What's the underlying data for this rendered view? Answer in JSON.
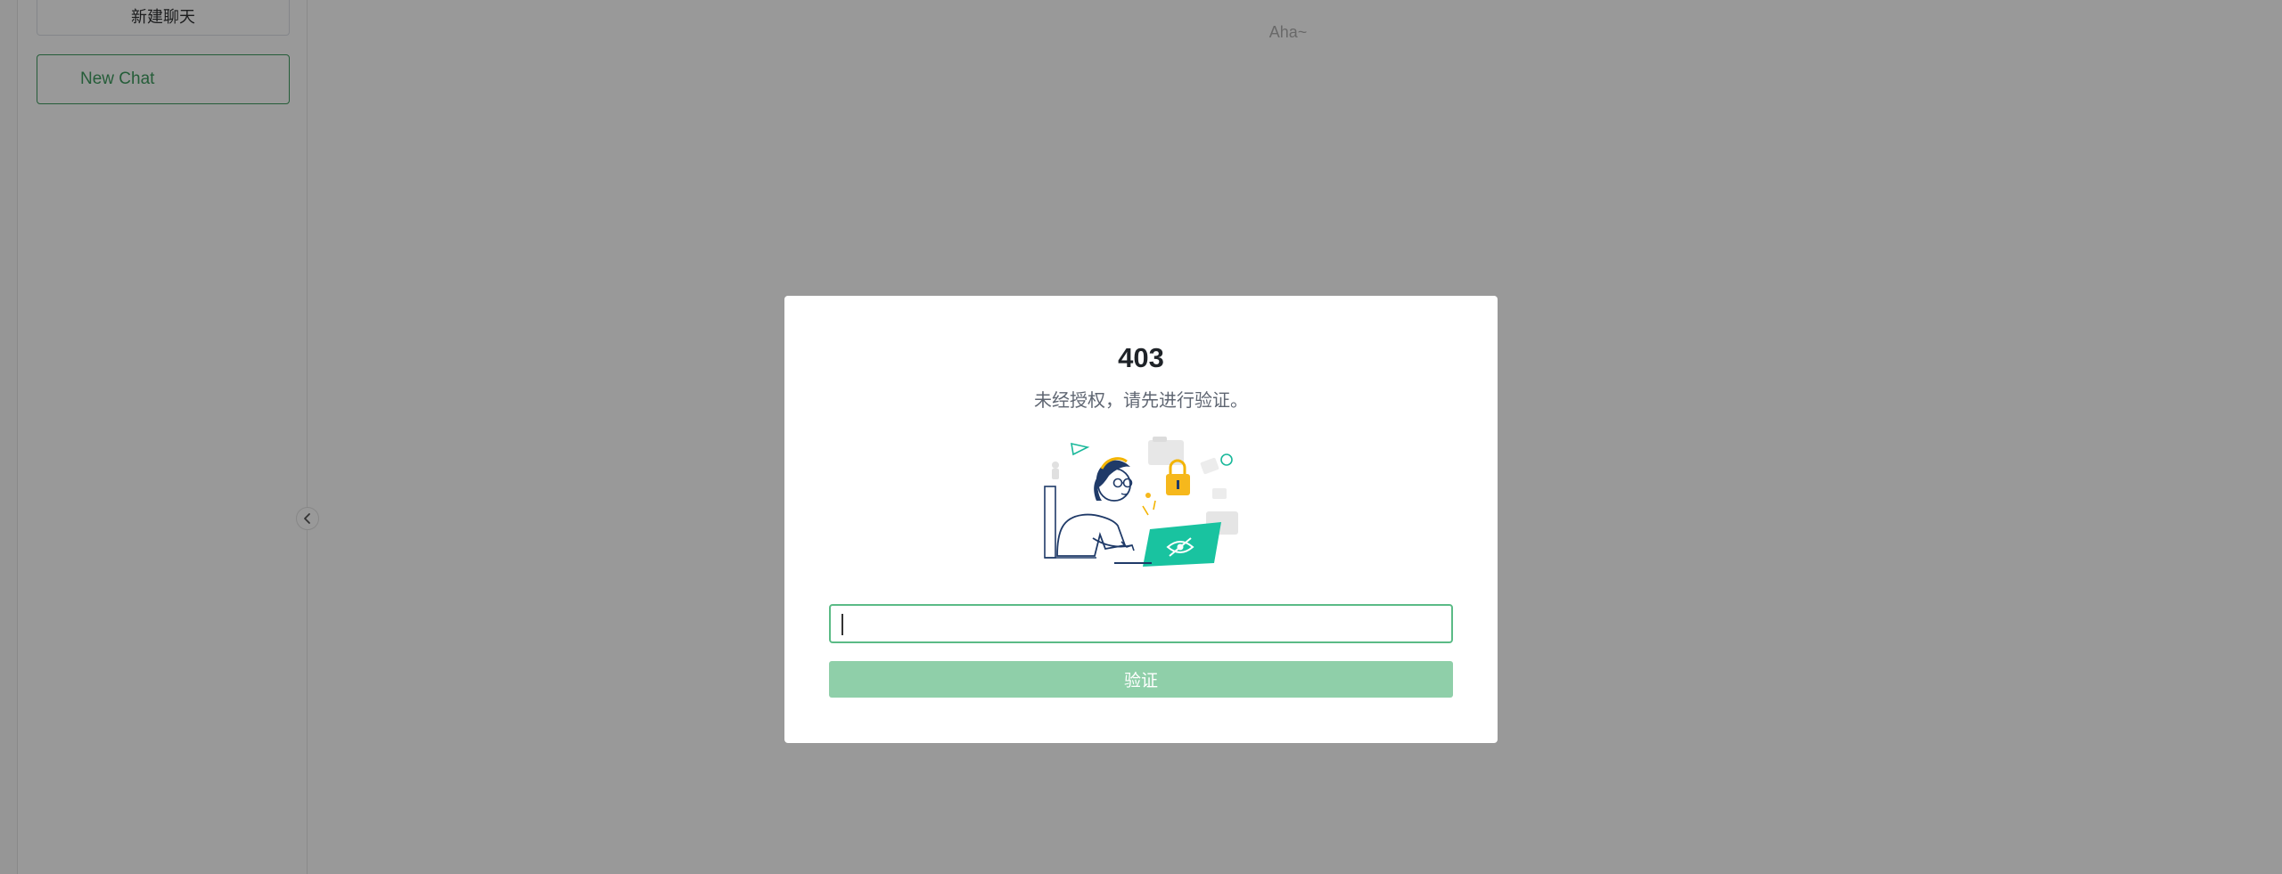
{
  "sidebar": {
    "new_chat_cn_label": "新建聊天",
    "new_chat_label": "New Chat"
  },
  "header": {
    "title": "Aha~"
  },
  "dialog": {
    "title": "403",
    "subtitle": "未经授权，请先进行验证。",
    "input_value": "",
    "input_placeholder": "",
    "verify_label": "验证",
    "verify_enabled": false
  },
  "colors": {
    "accent": "#3f9b5f",
    "button_disabled": "#8fcfa9",
    "input_border": "#5bbb86",
    "overlay": "rgba(0,0,0,0.40)"
  },
  "icons": {
    "collapse": "chevron-left-icon",
    "illustration": "unauthorized-illustration"
  }
}
